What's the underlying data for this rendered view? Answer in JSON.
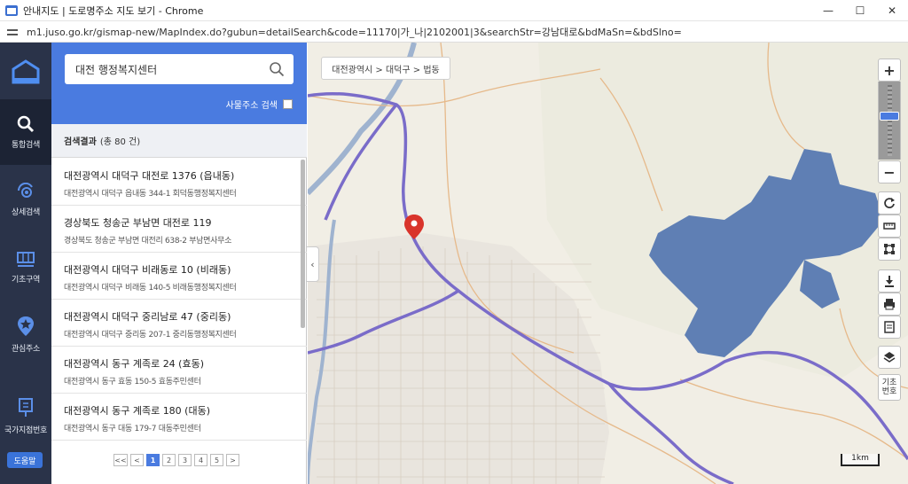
{
  "window": {
    "title": "안내지도 | 도로명주소 지도 보기 - Chrome",
    "url": "m1.juso.go.kr/gismap-new/MapIndex.do?gubun=detailSearch&code=11170|가_나|2102001|3&searchStr=강남대로&bdMaSn=&bdSlno="
  },
  "nav": {
    "items": [
      {
        "label": "통합검색",
        "icon": "search-icon"
      },
      {
        "label": "상세검색",
        "icon": "detail-search-icon"
      },
      {
        "label": "기초구역",
        "icon": "basic-zone-icon"
      },
      {
        "label": "관심주소",
        "icon": "favorite-pin-icon"
      },
      {
        "label": "국가지점번호",
        "icon": "national-point-icon"
      }
    ],
    "help_label": "도움말"
  },
  "search": {
    "value": "대전 행정복지센터",
    "building_search_label": "사물주소 검색"
  },
  "results_header": {
    "label": "검색결과",
    "count": "(총 80 건)"
  },
  "results": [
    {
      "road": "대전광역시 대덕구 대전로 1376 (읍내동)",
      "jibun": "대전광역시 대덕구 읍내동 344-1 회덕동행정복지센터"
    },
    {
      "road": "경상북도 청송군 부남면 대전로 119",
      "jibun": "경상북도 청송군 부남면 대전리 638-2 부남면사무소"
    },
    {
      "road": "대전광역시 대덕구 비래동로 10 (비래동)",
      "jibun": "대전광역시 대덕구 비래동 140-5 비래동행정복지센터"
    },
    {
      "road": "대전광역시 대덕구 중리남로 47 (중리동)",
      "jibun": "대전광역시 대덕구 중리동 207-1 중리동행정복지센터"
    },
    {
      "road": "대전광역시 동구 계족로 24 (효동)",
      "jibun": "대전광역시 동구 효동 150-5 효동주민센터"
    },
    {
      "road": "대전광역시 동구 계족로 180 (대동)",
      "jibun": "대전광역시 동구 대동 179-7 대동주민센터"
    }
  ],
  "pager": {
    "first": "<<",
    "prev": "<",
    "pages": [
      "1",
      "2",
      "3",
      "4",
      "5"
    ],
    "next": ">",
    "active": "1"
  },
  "map": {
    "breadcrumb": "대전광역시 > 대덕구 > 법동",
    "basic_number_label_1": "기초",
    "basic_number_label_2": "번호",
    "scale": "1km",
    "colors": {
      "water": "#5f7fb4",
      "highway": "#7a6cc9",
      "road": "#e6b98a",
      "marker": "#d9342b"
    }
  },
  "colors": {
    "nav_bg": "#2a3349",
    "accent": "#4a7be0"
  }
}
